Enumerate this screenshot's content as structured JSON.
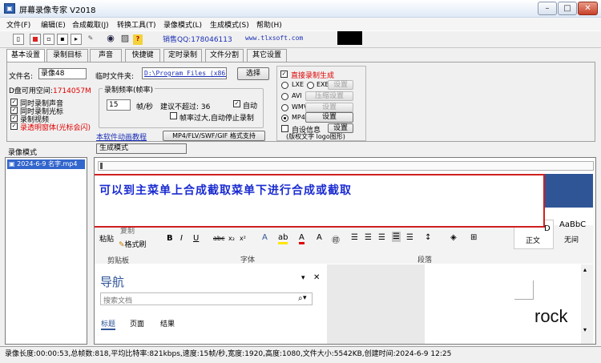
{
  "window": {
    "title": "屏幕录像专家 V2018",
    "app_icon": "film-icon",
    "controls": {
      "minimize": "minimize-icon",
      "maximize": "maximize-icon",
      "close": "close-icon"
    }
  },
  "menubar": {
    "items": [
      {
        "label": "文件(F)"
      },
      {
        "label": "编辑(E)"
      },
      {
        "label": "合成截取(J)"
      },
      {
        "label": "转换工具(T)"
      },
      {
        "label": "录像模式(L)"
      },
      {
        "label": "生成模式(S)"
      },
      {
        "label": "帮助(H)"
      }
    ]
  },
  "toolbar": {
    "contact": "销售QQ:178046113",
    "website": "www.tlxsoft.com"
  },
  "tabs": [
    {
      "label": "基本设置",
      "active": true
    },
    {
      "label": "录制目标"
    },
    {
      "label": "声音"
    },
    {
      "label": "快捷键"
    },
    {
      "label": "定时录制"
    },
    {
      "label": "文件分割"
    },
    {
      "label": "其它设置"
    }
  ],
  "settings": {
    "filename_label": "文件名:",
    "filename_value": "录像48",
    "temp_folder_label": "临时文件夹:",
    "temp_folder_value": "D:\\Program Files (x86)\\",
    "browse_button": "选择",
    "disk_space_label": "D盘可用空间:",
    "disk_space_value": "1714057M",
    "checkboxes": [
      {
        "label": "同时录制声音",
        "checked": true,
        "red": false
      },
      {
        "label": "同时录制光标",
        "checked": true,
        "red": false
      },
      {
        "label": "录制视频",
        "checked": true,
        "red": false
      },
      {
        "label": "录透明窗体(光标会闪)",
        "checked": true,
        "red": true
      }
    ],
    "frame_rate_group": "录制频率(帧率)",
    "frame_rate_value": "15",
    "frame_rate_unit": "帧/秒",
    "frame_rate_hint": "建议不超过: 36",
    "auto_label": "自动",
    "auto_checked": true,
    "overload_label": "帧率过大,自动停止录制",
    "overload_checked": false,
    "tutorial_link": "本软件动画教程",
    "formats_button": "MP4/FLV/SWF/GIF 格式支持"
  },
  "output": {
    "direct_label": "直接录制生成",
    "direct_checked": true,
    "options": [
      {
        "label": "LXE",
        "selected": false
      },
      {
        "label": "EXE",
        "selected": false
      },
      {
        "label": "AVI",
        "selected": false
      },
      {
        "label": "WMV",
        "selected": false
      },
      {
        "label": "MP4",
        "selected": true
      }
    ],
    "buttons": {
      "settings_disabled": "设置",
      "compress_settings": "压缩设置",
      "wmv_settings": "设置",
      "mp4_settings": "设置",
      "custom_settings": "设置"
    },
    "custom_info_label": "自设信息",
    "custom_info_checked": false,
    "logo_hint": "(版权文字 logo图形)"
  },
  "modes": {
    "record_mode": "录像模式",
    "generate_mode": "生成模式"
  },
  "file_list": [
    {
      "name": "2024-6-9 名字.mp4",
      "selected": true
    }
  ],
  "preview": {
    "message": "可以到主菜单上合成截取菜单下进行合成或截取",
    "word": {
      "paste": "粘贴",
      "copy": "复制",
      "format_painter": "格式刷",
      "clipboard": "剪贴板",
      "font": "字体",
      "paragraph": "段落",
      "style_preview": "AaBbC",
      "style_preview_d": "D",
      "style_normal": "正文",
      "style_nospacing": "无间",
      "nav_title": "导航",
      "nav_search": "搜索文档",
      "nav_tabs": [
        "标题",
        "页面",
        "结果"
      ],
      "watermark": "rock"
    }
  },
  "status": "录像长度:00:00:53,总帧数:818,平均比特率:821kbps,速度:15帧/秒,宽度:1920,高度:1080,文件大小:5542KB,创建时间:2024-6-9 12:25",
  "colors": {
    "accent_red": "#e00000",
    "link_blue": "#1b2fb5",
    "message_blue": "#1a2bd0",
    "selection_blue": "#3366cc"
  }
}
